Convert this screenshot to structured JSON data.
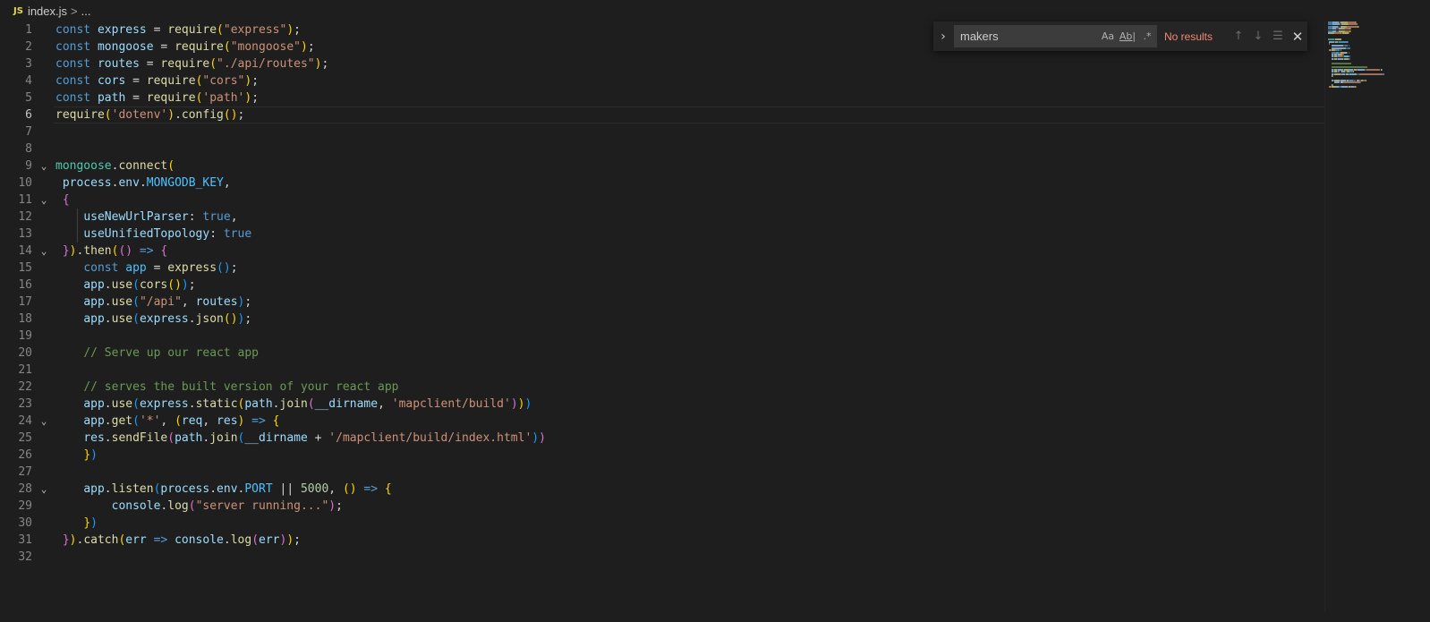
{
  "breadcrumb": {
    "lang_badge": "JS",
    "file": "index.js",
    "separator": ">",
    "ellipsis": "..."
  },
  "find": {
    "toggle_icon": "chevron-right-icon",
    "query": "makers",
    "match_case_label": "Aa",
    "whole_word_label": "Ab|",
    "regex_label": ".*",
    "status": "No results"
  },
  "colors": {
    "background": "#1e1e1e",
    "keyword": "#569cd6",
    "variable": "#9cdcfe",
    "function": "#dcdcaa",
    "string": "#ce9178",
    "comment": "#6a9955",
    "number": "#b5cea8",
    "status_error": "#f48771"
  },
  "editor": {
    "current_line": 6,
    "lines": [
      {
        "n": 1,
        "fold": "",
        "tokens": [
          [
            "kw",
            "const "
          ],
          [
            "var",
            "express"
          ],
          [
            "pun",
            " = "
          ],
          [
            "fn",
            "require"
          ],
          [
            "br1",
            "("
          ],
          [
            "str",
            "\"express\""
          ],
          [
            "br1",
            ")"
          ],
          [
            "pun",
            ";"
          ]
        ]
      },
      {
        "n": 2,
        "fold": "",
        "tokens": [
          [
            "kw",
            "const "
          ],
          [
            "var",
            "mongoose"
          ],
          [
            "pun",
            " = "
          ],
          [
            "fn",
            "require"
          ],
          [
            "br1",
            "("
          ],
          [
            "str",
            "\"mongoose\""
          ],
          [
            "br1",
            ")"
          ],
          [
            "pun",
            ";"
          ]
        ]
      },
      {
        "n": 3,
        "fold": "",
        "tokens": [
          [
            "kw",
            "const "
          ],
          [
            "var",
            "routes"
          ],
          [
            "pun",
            " = "
          ],
          [
            "fn",
            "require"
          ],
          [
            "br1",
            "("
          ],
          [
            "str",
            "\"./api/routes\""
          ],
          [
            "br1",
            ")"
          ],
          [
            "pun",
            ";"
          ]
        ]
      },
      {
        "n": 4,
        "fold": "",
        "tokens": [
          [
            "kw",
            "const "
          ],
          [
            "var",
            "cors"
          ],
          [
            "pun",
            " = "
          ],
          [
            "fn",
            "require"
          ],
          [
            "br1",
            "("
          ],
          [
            "str",
            "\"cors\""
          ],
          [
            "br1",
            ")"
          ],
          [
            "pun",
            ";"
          ]
        ]
      },
      {
        "n": 5,
        "fold": "",
        "tokens": [
          [
            "kw",
            "const "
          ],
          [
            "var",
            "path"
          ],
          [
            "pun",
            " = "
          ],
          [
            "fn",
            "require"
          ],
          [
            "br1",
            "("
          ],
          [
            "str",
            "'path'"
          ],
          [
            "br1",
            ")"
          ],
          [
            "pun",
            ";"
          ]
        ]
      },
      {
        "n": 6,
        "fold": "",
        "tokens": [
          [
            "fn",
            "require"
          ],
          [
            "br1",
            "("
          ],
          [
            "str",
            "'dotenv'"
          ],
          [
            "br1",
            ")"
          ],
          [
            "pun",
            "."
          ],
          [
            "fn",
            "config"
          ],
          [
            "br1",
            "()"
          ],
          [
            "pun",
            ";"
          ]
        ]
      },
      {
        "n": 7,
        "fold": "",
        "tokens": []
      },
      {
        "n": 8,
        "fold": "",
        "tokens": []
      },
      {
        "n": 9,
        "fold": "v",
        "tokens": [
          [
            "cls",
            "mongoose"
          ],
          [
            "pun",
            "."
          ],
          [
            "fn",
            "connect"
          ],
          [
            "br1",
            "("
          ]
        ]
      },
      {
        "n": 10,
        "fold": "",
        "tokens": [
          [
            "pun",
            " "
          ],
          [
            "var",
            "process"
          ],
          [
            "pun",
            "."
          ],
          [
            "var",
            "env"
          ],
          [
            "pun",
            "."
          ],
          [
            "const",
            "MONGODB_KEY"
          ],
          [
            "pun",
            ","
          ]
        ]
      },
      {
        "n": 11,
        "fold": "v",
        "tokens": [
          [
            "pun",
            " "
          ],
          [
            "br2",
            "{"
          ]
        ]
      },
      {
        "n": 12,
        "fold": "",
        "tokens": [
          [
            "pun",
            "    "
          ],
          [
            "var",
            "useNewUrlParser"
          ],
          [
            "pun",
            ": "
          ],
          [
            "bool",
            "true"
          ],
          [
            "pun",
            ","
          ]
        ]
      },
      {
        "n": 13,
        "fold": "",
        "tokens": [
          [
            "pun",
            "    "
          ],
          [
            "var",
            "useUnifiedTopology"
          ],
          [
            "pun",
            ": "
          ],
          [
            "bool",
            "true"
          ]
        ]
      },
      {
        "n": 14,
        "fold": "v",
        "tokens": [
          [
            "pun",
            " "
          ],
          [
            "br2",
            "}"
          ],
          [
            "br1",
            ")"
          ],
          [
            "pun",
            "."
          ],
          [
            "fn",
            "then"
          ],
          [
            "br1",
            "("
          ],
          [
            "br2",
            "()"
          ],
          [
            "kw",
            " => "
          ],
          [
            "br2",
            "{"
          ]
        ]
      },
      {
        "n": 15,
        "fold": "",
        "tokens": [
          [
            "pun",
            "    "
          ],
          [
            "kw",
            "const "
          ],
          [
            "const",
            "app"
          ],
          [
            "pun",
            " = "
          ],
          [
            "fn",
            "express"
          ],
          [
            "br3",
            "()"
          ],
          [
            "pun",
            ";"
          ]
        ]
      },
      {
        "n": 16,
        "fold": "",
        "tokens": [
          [
            "pun",
            "    "
          ],
          [
            "var",
            "app"
          ],
          [
            "pun",
            "."
          ],
          [
            "fn",
            "use"
          ],
          [
            "br3",
            "("
          ],
          [
            "fn",
            "cors"
          ],
          [
            "br1",
            "()"
          ],
          [
            "br3",
            ")"
          ],
          [
            "pun",
            ";"
          ]
        ]
      },
      {
        "n": 17,
        "fold": "",
        "tokens": [
          [
            "pun",
            "    "
          ],
          [
            "var",
            "app"
          ],
          [
            "pun",
            "."
          ],
          [
            "fn",
            "use"
          ],
          [
            "br3",
            "("
          ],
          [
            "str",
            "\"/api\""
          ],
          [
            "pun",
            ", "
          ],
          [
            "var",
            "routes"
          ],
          [
            "br3",
            ")"
          ],
          [
            "pun",
            ";"
          ]
        ]
      },
      {
        "n": 18,
        "fold": "",
        "tokens": [
          [
            "pun",
            "    "
          ],
          [
            "var",
            "app"
          ],
          [
            "pun",
            "."
          ],
          [
            "fn",
            "use"
          ],
          [
            "br3",
            "("
          ],
          [
            "var",
            "express"
          ],
          [
            "pun",
            "."
          ],
          [
            "fn",
            "json"
          ],
          [
            "br1",
            "()"
          ],
          [
            "br3",
            ")"
          ],
          [
            "pun",
            ";"
          ]
        ]
      },
      {
        "n": 19,
        "fold": "",
        "tokens": []
      },
      {
        "n": 20,
        "fold": "",
        "tokens": [
          [
            "pun",
            "    "
          ],
          [
            "cmt",
            "// Serve up our react app"
          ]
        ]
      },
      {
        "n": 21,
        "fold": "",
        "tokens": []
      },
      {
        "n": 22,
        "fold": "",
        "tokens": [
          [
            "pun",
            "    "
          ],
          [
            "cmt",
            "// serves the built version of your react app"
          ]
        ]
      },
      {
        "n": 23,
        "fold": "",
        "tokens": [
          [
            "pun",
            "    "
          ],
          [
            "var",
            "app"
          ],
          [
            "pun",
            "."
          ],
          [
            "fn",
            "use"
          ],
          [
            "br3",
            "("
          ],
          [
            "var",
            "express"
          ],
          [
            "pun",
            "."
          ],
          [
            "fn",
            "static"
          ],
          [
            "br1",
            "("
          ],
          [
            "var",
            "path"
          ],
          [
            "pun",
            "."
          ],
          [
            "fn",
            "join"
          ],
          [
            "br2",
            "("
          ],
          [
            "var",
            "__dirname"
          ],
          [
            "pun",
            ", "
          ],
          [
            "str",
            "'mapclient/build'"
          ],
          [
            "br2",
            ")"
          ],
          [
            "br1",
            ")"
          ],
          [
            "br3",
            ")"
          ]
        ]
      },
      {
        "n": 24,
        "fold": "v",
        "tokens": [
          [
            "pun",
            "    "
          ],
          [
            "var",
            "app"
          ],
          [
            "pun",
            "."
          ],
          [
            "fn",
            "get"
          ],
          [
            "br3",
            "("
          ],
          [
            "str",
            "'*'"
          ],
          [
            "pun",
            ", "
          ],
          [
            "br1",
            "("
          ],
          [
            "var",
            "req"
          ],
          [
            "pun",
            ", "
          ],
          [
            "var",
            "res"
          ],
          [
            "br1",
            ")"
          ],
          [
            "kw",
            " => "
          ],
          [
            "br1",
            "{"
          ]
        ]
      },
      {
        "n": 25,
        "fold": "",
        "tokens": [
          [
            "pun",
            "    "
          ],
          [
            "var",
            "res"
          ],
          [
            "pun",
            "."
          ],
          [
            "fn",
            "sendFile"
          ],
          [
            "br2",
            "("
          ],
          [
            "var",
            "path"
          ],
          [
            "pun",
            "."
          ],
          [
            "fn",
            "join"
          ],
          [
            "br3",
            "("
          ],
          [
            "var",
            "__dirname"
          ],
          [
            "pun",
            " + "
          ],
          [
            "str",
            "'/mapclient/build/index.html'"
          ],
          [
            "br3",
            ")"
          ],
          [
            "br2",
            ")"
          ]
        ]
      },
      {
        "n": 26,
        "fold": "",
        "tokens": [
          [
            "pun",
            "    "
          ],
          [
            "br1",
            "}"
          ],
          [
            "br3",
            ")"
          ]
        ]
      },
      {
        "n": 27,
        "fold": "",
        "tokens": []
      },
      {
        "n": 28,
        "fold": "v",
        "tokens": [
          [
            "pun",
            "    "
          ],
          [
            "var",
            "app"
          ],
          [
            "pun",
            "."
          ],
          [
            "fn",
            "listen"
          ],
          [
            "br3",
            "("
          ],
          [
            "var",
            "process"
          ],
          [
            "pun",
            "."
          ],
          [
            "var",
            "env"
          ],
          [
            "pun",
            "."
          ],
          [
            "const",
            "PORT"
          ],
          [
            "pun",
            " || "
          ],
          [
            "num",
            "5000"
          ],
          [
            "pun",
            ", "
          ],
          [
            "br1",
            "()"
          ],
          [
            "kw",
            " => "
          ],
          [
            "br1",
            "{"
          ]
        ]
      },
      {
        "n": 29,
        "fold": "",
        "tokens": [
          [
            "pun",
            "        "
          ],
          [
            "var",
            "console"
          ],
          [
            "pun",
            "."
          ],
          [
            "fn",
            "log"
          ],
          [
            "br2",
            "("
          ],
          [
            "str",
            "\"server running...\""
          ],
          [
            "br2",
            ")"
          ],
          [
            "pun",
            ";"
          ]
        ]
      },
      {
        "n": 30,
        "fold": "",
        "tokens": [
          [
            "pun",
            "    "
          ],
          [
            "br1",
            "}"
          ],
          [
            "br3",
            ")"
          ]
        ]
      },
      {
        "n": 31,
        "fold": "",
        "tokens": [
          [
            "pun",
            " "
          ],
          [
            "br2",
            "}"
          ],
          [
            "br1",
            ")"
          ],
          [
            "pun",
            "."
          ],
          [
            "fn",
            "catch"
          ],
          [
            "br1",
            "("
          ],
          [
            "var",
            "err"
          ],
          [
            "kw",
            " => "
          ],
          [
            "var",
            "console"
          ],
          [
            "pun",
            "."
          ],
          [
            "fn",
            "log"
          ],
          [
            "br2",
            "("
          ],
          [
            "var",
            "err"
          ],
          [
            "br2",
            ")"
          ],
          [
            "br1",
            ")"
          ],
          [
            "pun",
            ";"
          ]
        ]
      },
      {
        "n": 32,
        "fold": "",
        "tokens": []
      }
    ]
  }
}
